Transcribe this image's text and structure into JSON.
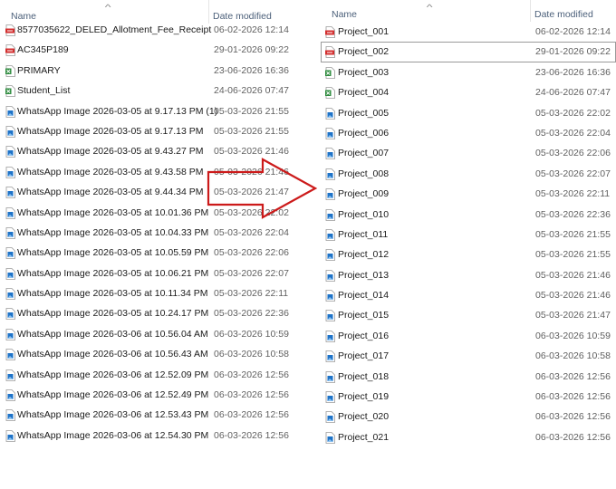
{
  "left_pane": {
    "header": {
      "name": "Name",
      "date_modified": "Date modified"
    },
    "files": [
      {
        "icon": "pdf-icon",
        "name": "8577035622_DELED_Allotment_Fee_Receipt",
        "date": "06-02-2026 12:14"
      },
      {
        "icon": "pdf-icon",
        "name": "AC345P189",
        "date": "29-01-2026 09:22"
      },
      {
        "icon": "spreadsheet-icon",
        "name": "PRIMARY",
        "date": "23-06-2026 16:36"
      },
      {
        "icon": "spreadsheet-icon",
        "name": "Student_List",
        "date": "24-06-2026 07:47"
      },
      {
        "icon": "image-icon",
        "name": "WhatsApp Image 2026-03-05 at 9.17.13 PM (1)",
        "date": "05-03-2026 21:55"
      },
      {
        "icon": "image-icon",
        "name": "WhatsApp Image 2026-03-05 at 9.17.13 PM",
        "date": "05-03-2026 21:55"
      },
      {
        "icon": "image-icon",
        "name": "WhatsApp Image 2026-03-05 at 9.43.27 PM",
        "date": "05-03-2026 21:46"
      },
      {
        "icon": "image-icon",
        "name": "WhatsApp Image 2026-03-05 at 9.43.58 PM",
        "date": "05-03-2026 21:46"
      },
      {
        "icon": "image-icon",
        "name": "WhatsApp Image 2026-03-05 at 9.44.34 PM",
        "date": "05-03-2026 21:47"
      },
      {
        "icon": "image-icon",
        "name": "WhatsApp Image 2026-03-05 at 10.01.36 PM",
        "date": "05-03-2026 22:02"
      },
      {
        "icon": "image-icon",
        "name": "WhatsApp Image 2026-03-05 at 10.04.33 PM",
        "date": "05-03-2026 22:04"
      },
      {
        "icon": "image-icon",
        "name": "WhatsApp Image 2026-03-05 at 10.05.59 PM",
        "date": "05-03-2026 22:06"
      },
      {
        "icon": "image-icon",
        "name": "WhatsApp Image 2026-03-05 at 10.06.21 PM",
        "date": "05-03-2026 22:07"
      },
      {
        "icon": "image-icon",
        "name": "WhatsApp Image 2026-03-05 at 10.11.34 PM",
        "date": "05-03-2026 22:11"
      },
      {
        "icon": "image-icon",
        "name": "WhatsApp Image 2026-03-05 at 10.24.17 PM",
        "date": "05-03-2026 22:36"
      },
      {
        "icon": "image-icon",
        "name": "WhatsApp Image 2026-03-06 at 10.56.04 AM",
        "date": "06-03-2026 10:59"
      },
      {
        "icon": "image-icon",
        "name": "WhatsApp Image 2026-03-06 at 10.56.43 AM",
        "date": "06-03-2026 10:58"
      },
      {
        "icon": "image-icon",
        "name": "WhatsApp Image 2026-03-06 at 12.52.09 PM",
        "date": "06-03-2026 12:56"
      },
      {
        "icon": "image-icon",
        "name": "WhatsApp Image 2026-03-06 at 12.52.49 PM",
        "date": "06-03-2026 12:56"
      },
      {
        "icon": "image-icon",
        "name": "WhatsApp Image 2026-03-06 at 12.53.43 PM",
        "date": "06-03-2026 12:56"
      },
      {
        "icon": "image-icon",
        "name": "WhatsApp Image 2026-03-06 at 12.54.30 PM",
        "date": "06-03-2026 12:56"
      }
    ]
  },
  "right_pane": {
    "header": {
      "name": "Name",
      "date_modified": "Date modified"
    },
    "files": [
      {
        "icon": "pdf-icon",
        "name": "Project_001",
        "date": "06-02-2026 12:14"
      },
      {
        "icon": "pdf-icon",
        "name": "Project_002",
        "date": "29-01-2026 09:22",
        "selected": true
      },
      {
        "icon": "spreadsheet-icon",
        "name": "Project_003",
        "date": "23-06-2026 16:36"
      },
      {
        "icon": "spreadsheet-icon",
        "name": "Project_004",
        "date": "24-06-2026 07:47"
      },
      {
        "icon": "image-icon",
        "name": "Project_005",
        "date": "05-03-2026 22:02"
      },
      {
        "icon": "image-icon",
        "name": "Project_006",
        "date": "05-03-2026 22:04"
      },
      {
        "icon": "image-icon",
        "name": "Project_007",
        "date": "05-03-2026 22:06"
      },
      {
        "icon": "image-icon",
        "name": "Project_008",
        "date": "05-03-2026 22:07"
      },
      {
        "icon": "image-icon",
        "name": "Project_009",
        "date": "05-03-2026 22:11"
      },
      {
        "icon": "image-icon",
        "name": "Project_010",
        "date": "05-03-2026 22:36"
      },
      {
        "icon": "image-icon",
        "name": "Project_011",
        "date": "05-03-2026 21:55"
      },
      {
        "icon": "image-icon",
        "name": "Project_012",
        "date": "05-03-2026 21:55"
      },
      {
        "icon": "image-icon",
        "name": "Project_013",
        "date": "05-03-2026 21:46"
      },
      {
        "icon": "image-icon",
        "name": "Project_014",
        "date": "05-03-2026 21:46"
      },
      {
        "icon": "image-icon",
        "name": "Project_015",
        "date": "05-03-2026 21:47"
      },
      {
        "icon": "image-icon",
        "name": "Project_016",
        "date": "06-03-2026 10:59"
      },
      {
        "icon": "image-icon",
        "name": "Project_017",
        "date": "06-03-2026 10:58"
      },
      {
        "icon": "image-icon",
        "name": "Project_018",
        "date": "06-03-2026 12:56"
      },
      {
        "icon": "image-icon",
        "name": "Project_019",
        "date": "06-03-2026 12:56"
      },
      {
        "icon": "image-icon",
        "name": "Project_020",
        "date": "06-03-2026 12:56"
      },
      {
        "icon": "image-icon",
        "name": "Project_021",
        "date": "06-03-2026 12:56"
      }
    ]
  },
  "colors": {
    "arrow_stroke": "#cc1a1a",
    "header_text": "#4c607a",
    "date_text": "#606060",
    "pdf_icon": "#d32f2f",
    "image_icon": "#1e73c8",
    "spreadsheet_icon": "#2e8b3e"
  }
}
